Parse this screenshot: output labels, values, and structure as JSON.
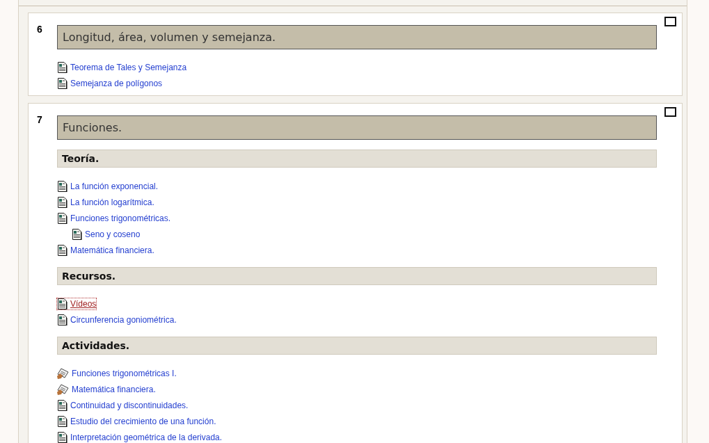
{
  "sections": [
    {
      "number": "6",
      "title": "Longitud, área, volumen y semejanza.",
      "checked": false,
      "content": [
        {
          "kind": "resource",
          "label": "Teorema de Tales y Semejanza",
          "focused": false
        },
        {
          "kind": "resource",
          "label": "Semejanza de polígonos",
          "focused": false
        }
      ]
    },
    {
      "number": "7",
      "title": "Funciones.",
      "checked": false,
      "content": [
        {
          "kind": "heading",
          "label": "Teoría."
        },
        {
          "kind": "resource",
          "label": "La función exponencial.",
          "focused": false
        },
        {
          "kind": "resource",
          "label": "La función logarítmica.",
          "focused": false
        },
        {
          "kind": "resource",
          "label": "Funciones trigonométricas.",
          "focused": false,
          "children": [
            {
              "kind": "resource",
              "label": "Seno y coseno",
              "focused": false
            }
          ]
        },
        {
          "kind": "resource",
          "label": "Matemática financiera.",
          "focused": false
        },
        {
          "kind": "heading",
          "label": "Recursos."
        },
        {
          "kind": "resource",
          "label": "Vídeos",
          "focused": true
        },
        {
          "kind": "resource",
          "label": "Circunferencia goniométrica.",
          "focused": false
        },
        {
          "kind": "heading",
          "label": "Actividades."
        },
        {
          "kind": "quiz",
          "label": "Funciones trigonométricas I.",
          "focused": false
        },
        {
          "kind": "quiz",
          "label": "Matemática financiera.",
          "focused": false
        },
        {
          "kind": "resource",
          "label": "Continuidad y discontinuidades.",
          "focused": false
        },
        {
          "kind": "resource",
          "label": "Estudio del crecimiento de una función.",
          "focused": false
        },
        {
          "kind": "resource",
          "label": "Interpretación geométrica de la derivada.",
          "focused": false
        }
      ]
    }
  ]
}
